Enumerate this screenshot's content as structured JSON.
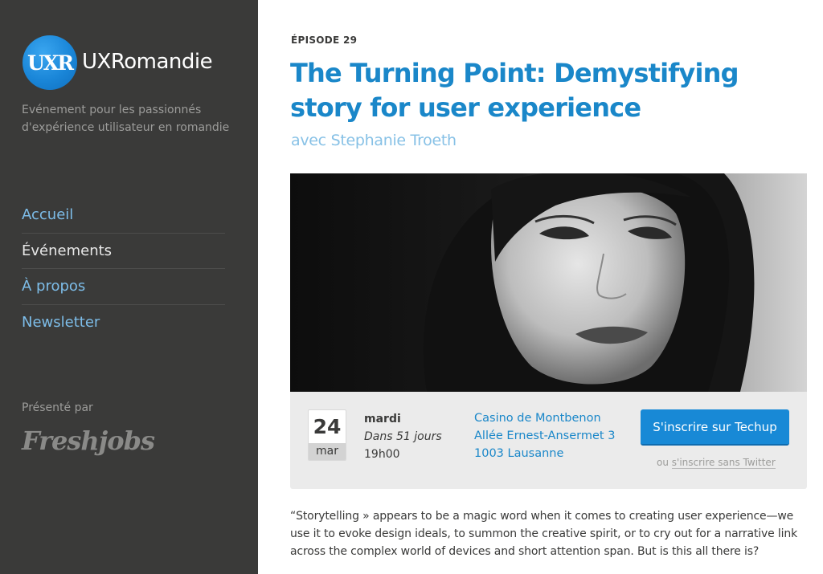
{
  "sidebar": {
    "logo_mark": "UXR",
    "site_name": "UXRomandie",
    "tagline": "Evénement pour les passionnés d'expérience utilisateur en romandie",
    "nav": [
      {
        "label": "Accueil",
        "active": false
      },
      {
        "label": "Événements",
        "active": true
      },
      {
        "label": "À propos",
        "active": false
      },
      {
        "label": "Newsletter",
        "active": false
      }
    ],
    "presented_by": "Présenté par",
    "sponsor": "Freshjobs"
  },
  "main": {
    "episode": "ÉPISODE 29",
    "title": "The Turning Point: Demystifying story for user experience",
    "subtitle": "avec Stephanie Troeth",
    "event": {
      "day": "24",
      "month": "mar",
      "weekday": "mardi",
      "countdown": "Dans 51 jours",
      "time": "19h00",
      "venue": "Casino de Montbenon",
      "street": "Allée Ernest-Ansermet 3",
      "city": "1003 Lausanne",
      "cta_label": "S'inscrire sur Techup",
      "alt_prefix": "ou",
      "alt_link": "s'inscrire sans Twitter"
    },
    "description": "“Storytelling » appears to be a magic word when it comes to creating user experience—we use it to evoke design ideals, to summon the creative spirit, or to cry out for a narrative link across the complex world of devices and short attention span. But is this all there is?"
  },
  "colors": {
    "sidebar_bg": "#3a3a39",
    "accent": "#1a87c9",
    "button": "#1889d6"
  }
}
